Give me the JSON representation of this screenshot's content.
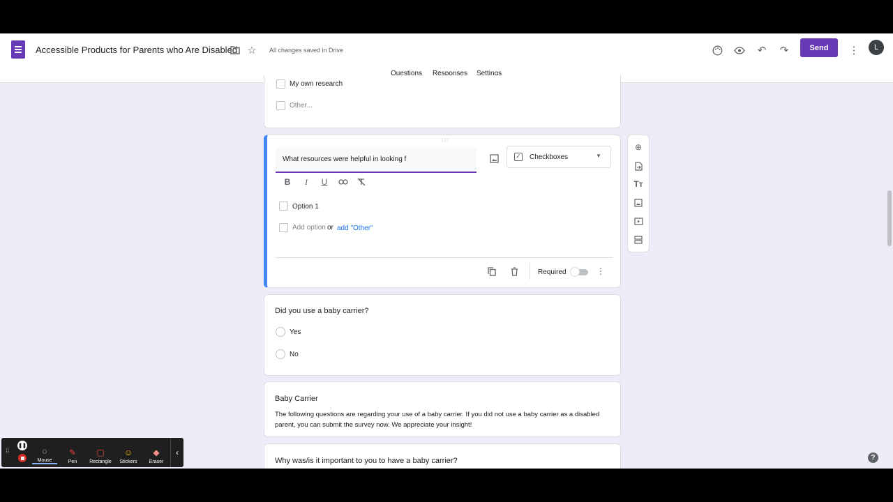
{
  "header": {
    "title": "Accessible Products for Parents who Are Disabled",
    "saved_status": "All changes saved in Drive",
    "send_label": "Send",
    "avatar_letter": "L",
    "tabs": [
      {
        "label": "Questions",
        "active": true
      },
      {
        "label": "Responses",
        "active": false
      },
      {
        "label": "Settings",
        "active": false
      }
    ]
  },
  "prev_question": {
    "options": [
      "My own research",
      "Other..."
    ]
  },
  "active_question": {
    "title_value": "What resources were helpful in looking f",
    "type_label": "Checkboxes",
    "options": [
      "Option 1"
    ],
    "add_option": "Add option",
    "or": "or",
    "add_other": "add \"Other\"",
    "required_label": "Required",
    "required": false
  },
  "q_baby_carrier": {
    "title": "Did you use a baby carrier?",
    "options": [
      "Yes",
      "No"
    ]
  },
  "section": {
    "title": "Baby Carrier",
    "description": "The following questions are regarding your use of a baby carrier. If you did not use a baby carrier as a disabled parent, you can submit the survey now. We appreciate your insight!"
  },
  "next_question": {
    "title": "Why was/is it important to you to have a baby carrier?"
  },
  "recorder": {
    "tools": [
      "Mouse",
      "Pen",
      "Rectangle",
      "Stickers",
      "Eraser"
    ]
  },
  "colors": {
    "accent": "#673ab7",
    "active_border": "#4285f4",
    "background": "#f0ebf8"
  }
}
